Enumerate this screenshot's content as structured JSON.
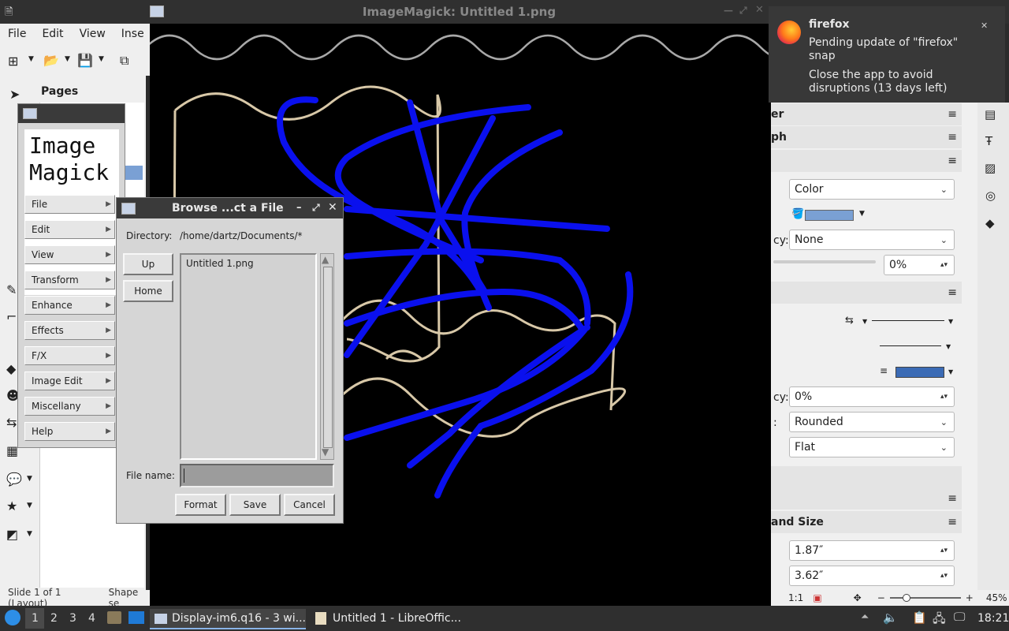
{
  "lo": {
    "menu": [
      "File",
      "Edit",
      "View",
      "Inse"
    ],
    "pages_label": "Pages",
    "status_left": "Slide 1 of 1 (Layout)",
    "status_shape": "Shape se",
    "zoom_ratio": "1:1",
    "zoom_percent": "45%",
    "sidebar": {
      "section_r": "er",
      "section_ph": "ph",
      "fill_type": "Color",
      "transparency_label": "cy:",
      "transparency_value": "None",
      "transparency_pct": "0%",
      "line_transparency_label": "cy:",
      "line_transparency_pct": "0%",
      "corner_label": ":",
      "corner_style": "Rounded",
      "cap_style": "Flat",
      "position_size_title": "and Size",
      "width_value": "1.87″",
      "height_value": "3.62″",
      "fill_color": "#7aa0d4",
      "line_color": "#3b6bb5"
    }
  },
  "im": {
    "title": "ImageMagick: Untitled 1.png",
    "logo_line1": "Image",
    "logo_line2": "Magick",
    "commands": [
      "File",
      "Edit",
      "View",
      "Transform",
      "Enhance",
      "Effects",
      "F/X",
      "Image Edit",
      "Miscellany",
      "Help"
    ]
  },
  "browse": {
    "title": "Browse ...ct a File",
    "directory_label": "Directory:",
    "directory_value": "/home/dartz/Documents/*",
    "up_label": "Up",
    "home_label": "Home",
    "files": [
      "Untitled 1.png"
    ],
    "filename_label": "File name:",
    "filename_value": "",
    "format_label": "Format",
    "save_label": "Save",
    "cancel_label": "Cancel"
  },
  "notification": {
    "app": "firefox",
    "line1": "Pending update of \"firefox\" snap",
    "line2": "Close the app to avoid disruptions (13 days left)"
  },
  "taskbar": {
    "workspaces": [
      "1",
      "2",
      "3",
      "4"
    ],
    "task1": "Display-im6.q16 - 3 wi...",
    "task2": "Untitled 1 - LibreOffic...",
    "clock": "18:21"
  }
}
